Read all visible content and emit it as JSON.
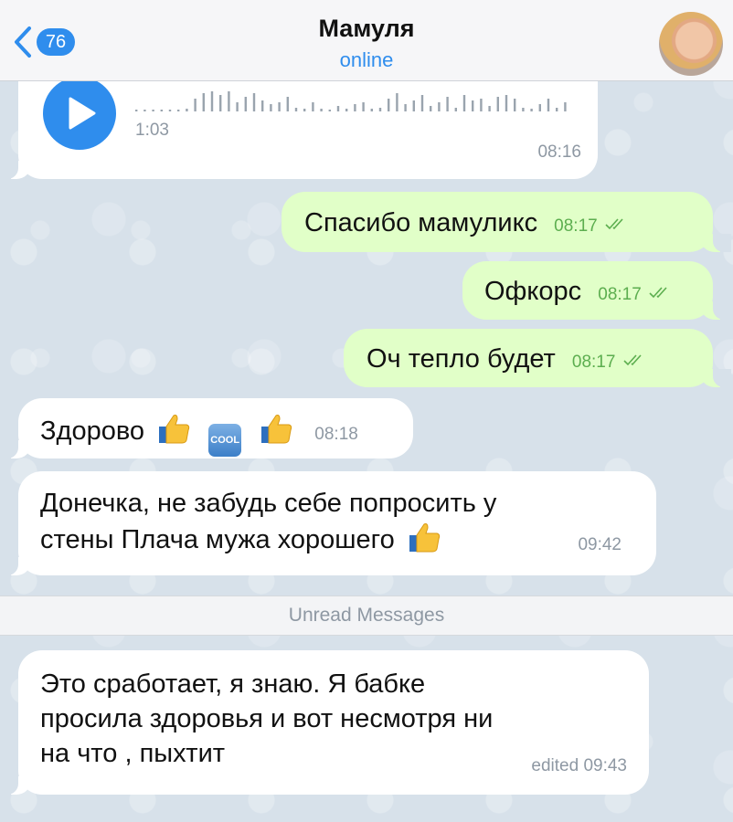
{
  "header": {
    "back_count": "76",
    "title": "Мамуля",
    "status": "online"
  },
  "messages": [
    {
      "kind": "voice",
      "direction": "in",
      "duration": "1:03",
      "time": "08:16"
    },
    {
      "kind": "text",
      "direction": "out",
      "text": "Спасибо мамуликс",
      "time": "08:17",
      "read": true
    },
    {
      "kind": "text",
      "direction": "out",
      "text": "Офкорс",
      "time": "08:17",
      "read": true
    },
    {
      "kind": "text",
      "direction": "out",
      "text": "Оч тепло будет",
      "time": "08:17",
      "read": true
    },
    {
      "kind": "text",
      "direction": "in",
      "text": "Здорово",
      "emoji": [
        "thumbs-up",
        "cool-button",
        "thumbs-up"
      ],
      "cool_text": "COOL",
      "time": "08:18"
    },
    {
      "kind": "text",
      "direction": "in",
      "lines": [
        "Донечка, не забудь  себе попросить у",
        "стены Плача мужа  хорошего"
      ],
      "emoji": [
        "thumbs-up"
      ],
      "time": "09:42"
    },
    {
      "kind": "text",
      "direction": "in",
      "lines": [
        "Это  сработает,  я знаю. Я бабке",
        "просила здоровья  и вот несмотря ни",
        "на что , пыхтит"
      ],
      "time": "edited 09:43"
    }
  ],
  "unread_label": "Unread Messages",
  "colors": {
    "accent": "#2f8ded",
    "outgoing_bubble": "#e1ffc8",
    "incoming_bubble": "#ffffff",
    "check_marks": "#5cae4f",
    "timestamp_in": "#8e98a3"
  }
}
